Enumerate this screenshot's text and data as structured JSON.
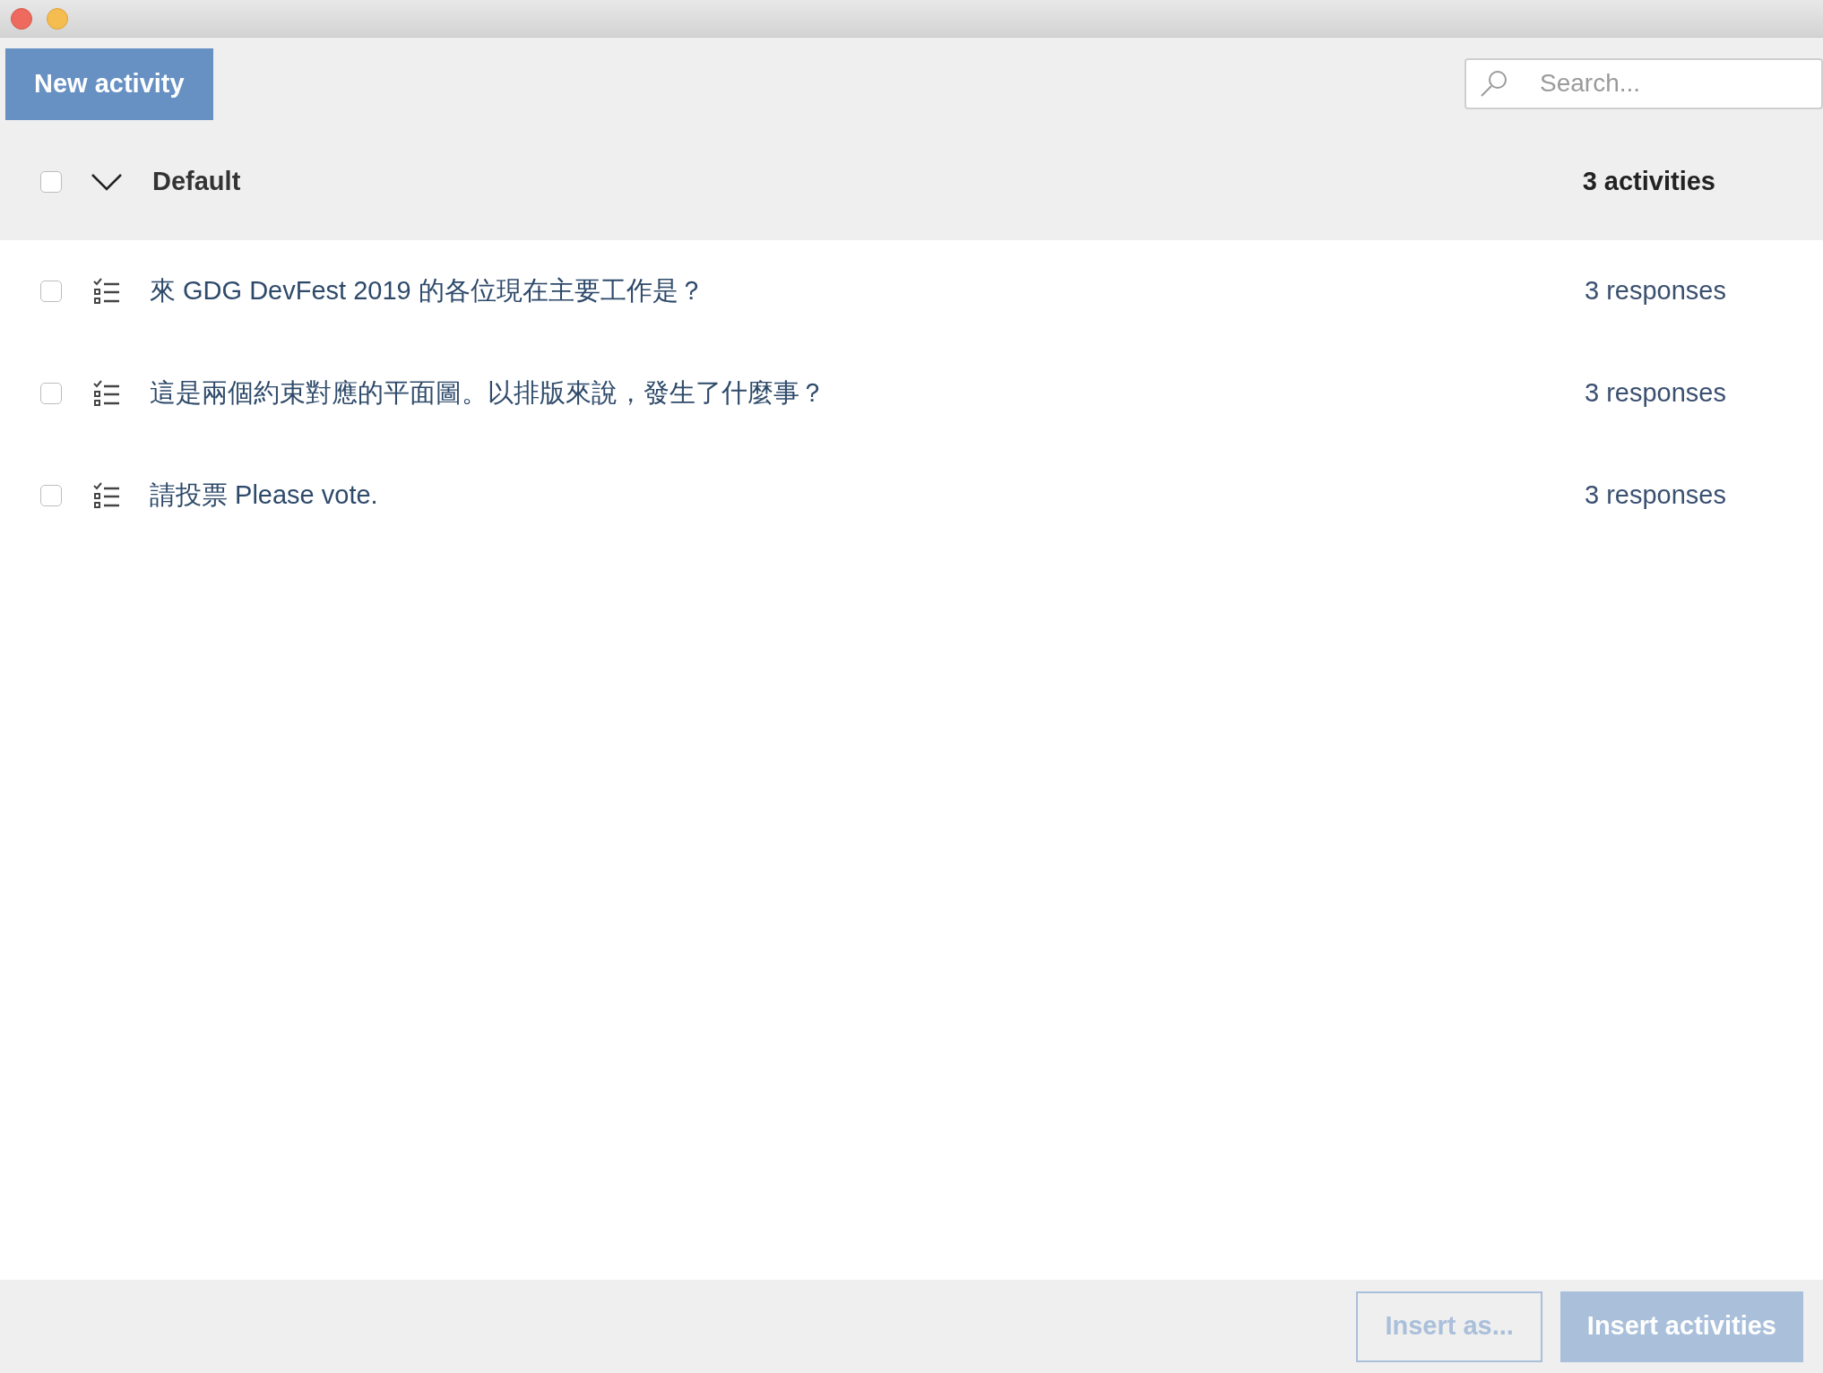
{
  "toolbar": {
    "new_button": "New activity",
    "search": {
      "placeholder": "Search..."
    }
  },
  "group": {
    "name": "Default",
    "checked": false,
    "expanded": true,
    "count": "3 activities"
  },
  "activities": [
    {
      "title": "來 GDG DevFest 2019 的各位現在主要工作是？",
      "responses": "3 responses",
      "checked": false
    },
    {
      "title": "這是兩個約束對應的平面圖。以排版來說，發生了什麼事？",
      "responses": "3 responses",
      "checked": false
    },
    {
      "title": "請投票 Please vote.",
      "responses": "3 responses",
      "checked": false
    }
  ],
  "footer": {
    "buttons": [
      {
        "label": "Insert as...",
        "kind": "outline",
        "disabled": true
      },
      {
        "label": "Insert activities",
        "kind": "primary",
        "disabled": true
      }
    ]
  }
}
